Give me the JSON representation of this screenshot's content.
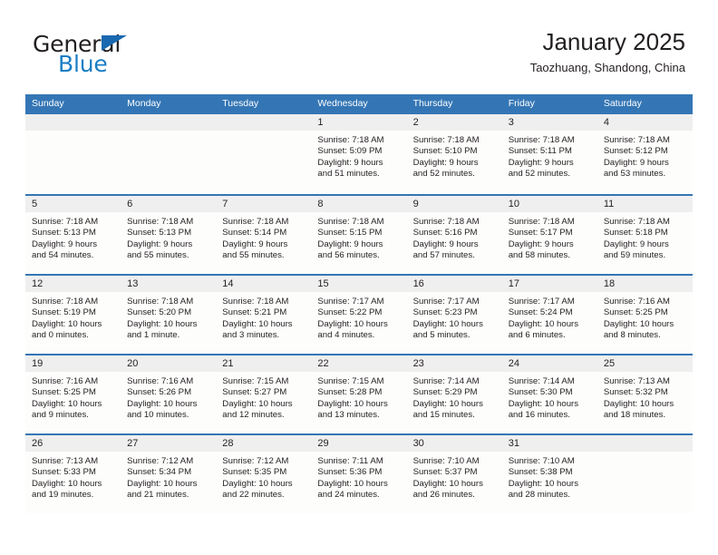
{
  "brand": {
    "name_part1": "General",
    "name_part2": "Blue",
    "triangle_icon": "blue-triangle-icon",
    "colors": {
      "dark": "#231f20",
      "blue": "#1a7dc4",
      "triangle": "#1a69b0"
    }
  },
  "header": {
    "title": "January 2025",
    "subtitle": "Taozhuang, Shandong, China"
  },
  "theme": {
    "header_blue": "#3476b5",
    "daynum_band": "#efefef",
    "cell_bg": "#fdfdfc",
    "text": "#231f20"
  },
  "weekdays": [
    "Sunday",
    "Monday",
    "Tuesday",
    "Wednesday",
    "Thursday",
    "Friday",
    "Saturday"
  ],
  "weeks": [
    [
      {
        "day": "",
        "sunrise": "",
        "sunset": "",
        "daylight_line1": "",
        "daylight_line2": ""
      },
      {
        "day": "",
        "sunrise": "",
        "sunset": "",
        "daylight_line1": "",
        "daylight_line2": ""
      },
      {
        "day": "",
        "sunrise": "",
        "sunset": "",
        "daylight_line1": "",
        "daylight_line2": ""
      },
      {
        "day": "1",
        "sunrise": "Sunrise: 7:18 AM",
        "sunset": "Sunset: 5:09 PM",
        "daylight_line1": "Daylight: 9 hours",
        "daylight_line2": "and 51 minutes."
      },
      {
        "day": "2",
        "sunrise": "Sunrise: 7:18 AM",
        "sunset": "Sunset: 5:10 PM",
        "daylight_line1": "Daylight: 9 hours",
        "daylight_line2": "and 52 minutes."
      },
      {
        "day": "3",
        "sunrise": "Sunrise: 7:18 AM",
        "sunset": "Sunset: 5:11 PM",
        "daylight_line1": "Daylight: 9 hours",
        "daylight_line2": "and 52 minutes."
      },
      {
        "day": "4",
        "sunrise": "Sunrise: 7:18 AM",
        "sunset": "Sunset: 5:12 PM",
        "daylight_line1": "Daylight: 9 hours",
        "daylight_line2": "and 53 minutes."
      }
    ],
    [
      {
        "day": "5",
        "sunrise": "Sunrise: 7:18 AM",
        "sunset": "Sunset: 5:13 PM",
        "daylight_line1": "Daylight: 9 hours",
        "daylight_line2": "and 54 minutes."
      },
      {
        "day": "6",
        "sunrise": "Sunrise: 7:18 AM",
        "sunset": "Sunset: 5:13 PM",
        "daylight_line1": "Daylight: 9 hours",
        "daylight_line2": "and 55 minutes."
      },
      {
        "day": "7",
        "sunrise": "Sunrise: 7:18 AM",
        "sunset": "Sunset: 5:14 PM",
        "daylight_line1": "Daylight: 9 hours",
        "daylight_line2": "and 55 minutes."
      },
      {
        "day": "8",
        "sunrise": "Sunrise: 7:18 AM",
        "sunset": "Sunset: 5:15 PM",
        "daylight_line1": "Daylight: 9 hours",
        "daylight_line2": "and 56 minutes."
      },
      {
        "day": "9",
        "sunrise": "Sunrise: 7:18 AM",
        "sunset": "Sunset: 5:16 PM",
        "daylight_line1": "Daylight: 9 hours",
        "daylight_line2": "and 57 minutes."
      },
      {
        "day": "10",
        "sunrise": "Sunrise: 7:18 AM",
        "sunset": "Sunset: 5:17 PM",
        "daylight_line1": "Daylight: 9 hours",
        "daylight_line2": "and 58 minutes."
      },
      {
        "day": "11",
        "sunrise": "Sunrise: 7:18 AM",
        "sunset": "Sunset: 5:18 PM",
        "daylight_line1": "Daylight: 9 hours",
        "daylight_line2": "and 59 minutes."
      }
    ],
    [
      {
        "day": "12",
        "sunrise": "Sunrise: 7:18 AM",
        "sunset": "Sunset: 5:19 PM",
        "daylight_line1": "Daylight: 10 hours",
        "daylight_line2": "and 0 minutes."
      },
      {
        "day": "13",
        "sunrise": "Sunrise: 7:18 AM",
        "sunset": "Sunset: 5:20 PM",
        "daylight_line1": "Daylight: 10 hours",
        "daylight_line2": "and 1 minute."
      },
      {
        "day": "14",
        "sunrise": "Sunrise: 7:18 AM",
        "sunset": "Sunset: 5:21 PM",
        "daylight_line1": "Daylight: 10 hours",
        "daylight_line2": "and 3 minutes."
      },
      {
        "day": "15",
        "sunrise": "Sunrise: 7:17 AM",
        "sunset": "Sunset: 5:22 PM",
        "daylight_line1": "Daylight: 10 hours",
        "daylight_line2": "and 4 minutes."
      },
      {
        "day": "16",
        "sunrise": "Sunrise: 7:17 AM",
        "sunset": "Sunset: 5:23 PM",
        "daylight_line1": "Daylight: 10 hours",
        "daylight_line2": "and 5 minutes."
      },
      {
        "day": "17",
        "sunrise": "Sunrise: 7:17 AM",
        "sunset": "Sunset: 5:24 PM",
        "daylight_line1": "Daylight: 10 hours",
        "daylight_line2": "and 6 minutes."
      },
      {
        "day": "18",
        "sunrise": "Sunrise: 7:16 AM",
        "sunset": "Sunset: 5:25 PM",
        "daylight_line1": "Daylight: 10 hours",
        "daylight_line2": "and 8 minutes."
      }
    ],
    [
      {
        "day": "19",
        "sunrise": "Sunrise: 7:16 AM",
        "sunset": "Sunset: 5:25 PM",
        "daylight_line1": "Daylight: 10 hours",
        "daylight_line2": "and 9 minutes."
      },
      {
        "day": "20",
        "sunrise": "Sunrise: 7:16 AM",
        "sunset": "Sunset: 5:26 PM",
        "daylight_line1": "Daylight: 10 hours",
        "daylight_line2": "and 10 minutes."
      },
      {
        "day": "21",
        "sunrise": "Sunrise: 7:15 AM",
        "sunset": "Sunset: 5:27 PM",
        "daylight_line1": "Daylight: 10 hours",
        "daylight_line2": "and 12 minutes."
      },
      {
        "day": "22",
        "sunrise": "Sunrise: 7:15 AM",
        "sunset": "Sunset: 5:28 PM",
        "daylight_line1": "Daylight: 10 hours",
        "daylight_line2": "and 13 minutes."
      },
      {
        "day": "23",
        "sunrise": "Sunrise: 7:14 AM",
        "sunset": "Sunset: 5:29 PM",
        "daylight_line1": "Daylight: 10 hours",
        "daylight_line2": "and 15 minutes."
      },
      {
        "day": "24",
        "sunrise": "Sunrise: 7:14 AM",
        "sunset": "Sunset: 5:30 PM",
        "daylight_line1": "Daylight: 10 hours",
        "daylight_line2": "and 16 minutes."
      },
      {
        "day": "25",
        "sunrise": "Sunrise: 7:13 AM",
        "sunset": "Sunset: 5:32 PM",
        "daylight_line1": "Daylight: 10 hours",
        "daylight_line2": "and 18 minutes."
      }
    ],
    [
      {
        "day": "26",
        "sunrise": "Sunrise: 7:13 AM",
        "sunset": "Sunset: 5:33 PM",
        "daylight_line1": "Daylight: 10 hours",
        "daylight_line2": "and 19 minutes."
      },
      {
        "day": "27",
        "sunrise": "Sunrise: 7:12 AM",
        "sunset": "Sunset: 5:34 PM",
        "daylight_line1": "Daylight: 10 hours",
        "daylight_line2": "and 21 minutes."
      },
      {
        "day": "28",
        "sunrise": "Sunrise: 7:12 AM",
        "sunset": "Sunset: 5:35 PM",
        "daylight_line1": "Daylight: 10 hours",
        "daylight_line2": "and 22 minutes."
      },
      {
        "day": "29",
        "sunrise": "Sunrise: 7:11 AM",
        "sunset": "Sunset: 5:36 PM",
        "daylight_line1": "Daylight: 10 hours",
        "daylight_line2": "and 24 minutes."
      },
      {
        "day": "30",
        "sunrise": "Sunrise: 7:10 AM",
        "sunset": "Sunset: 5:37 PM",
        "daylight_line1": "Daylight: 10 hours",
        "daylight_line2": "and 26 minutes."
      },
      {
        "day": "31",
        "sunrise": "Sunrise: 7:10 AM",
        "sunset": "Sunset: 5:38 PM",
        "daylight_line1": "Daylight: 10 hours",
        "daylight_line2": "and 28 minutes."
      },
      {
        "day": "",
        "sunrise": "",
        "sunset": "",
        "daylight_line1": "",
        "daylight_line2": ""
      }
    ]
  ]
}
